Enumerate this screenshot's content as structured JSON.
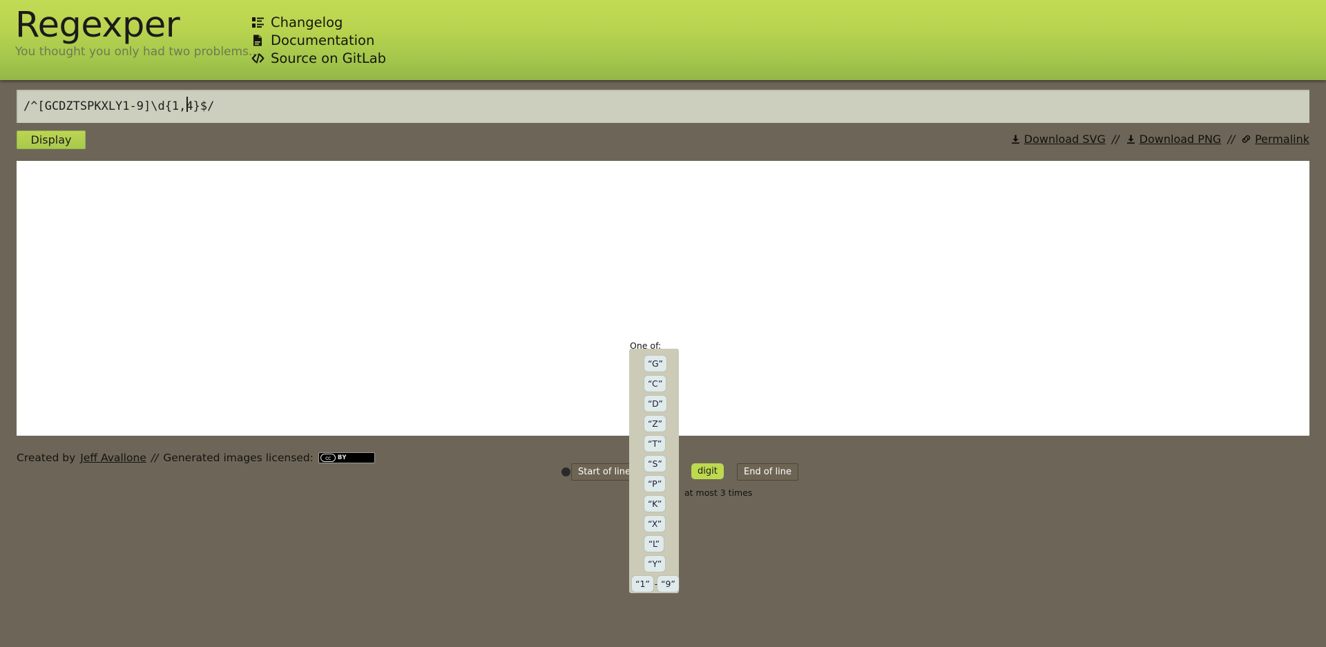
{
  "header": {
    "app_title": "Regexper",
    "tagline": "You thought you only had two problems...",
    "nav": [
      {
        "label": "Changelog",
        "icon": "list-icon"
      },
      {
        "label": "Documentation",
        "icon": "document-icon"
      },
      {
        "label": "Source on GitLab",
        "icon": "code-icon"
      }
    ]
  },
  "input": {
    "value": "/^[GCDZTSPKXLY1-9]\\d{1,4}$/",
    "placeholder": ""
  },
  "toolbar": {
    "display_label": "Display",
    "download_svg_label": "Download SVG",
    "download_png_label": "Download PNG",
    "permalink_label": "Permalink",
    "separator": "//"
  },
  "diagram": {
    "charclass_label": "One of:",
    "charclass_items": [
      "“G”",
      "“C”",
      "“D”",
      "“Z”",
      "“T”",
      "“S”",
      "“P”",
      "“K”",
      "“X”",
      "“L”",
      "“Y”"
    ],
    "range_from": "“1”",
    "range_dash": "-",
    "range_to": "“9”",
    "start_node": "Start of line",
    "digit_node": "digit",
    "quantifier": "at most 3 times",
    "end_node": "End of line"
  },
  "footer": {
    "created_by_prefix": "Created by",
    "author": "Jeff Avallone",
    "separator": "//",
    "license_text": "Generated images licensed:",
    "cc_mark": "cc",
    "cc_by": "BY"
  },
  "colors": {
    "header_green_light": "#c2db55",
    "header_green_dark": "#93b748",
    "page_background": "#6d6658",
    "input_background": "#cdcfbe",
    "canvas_background": "#ffffff",
    "node_anchor": "#6d6454",
    "node_digit": "#bcd94f",
    "charclass_container": "#cbcbb8",
    "char_item": "#dfeaea"
  }
}
